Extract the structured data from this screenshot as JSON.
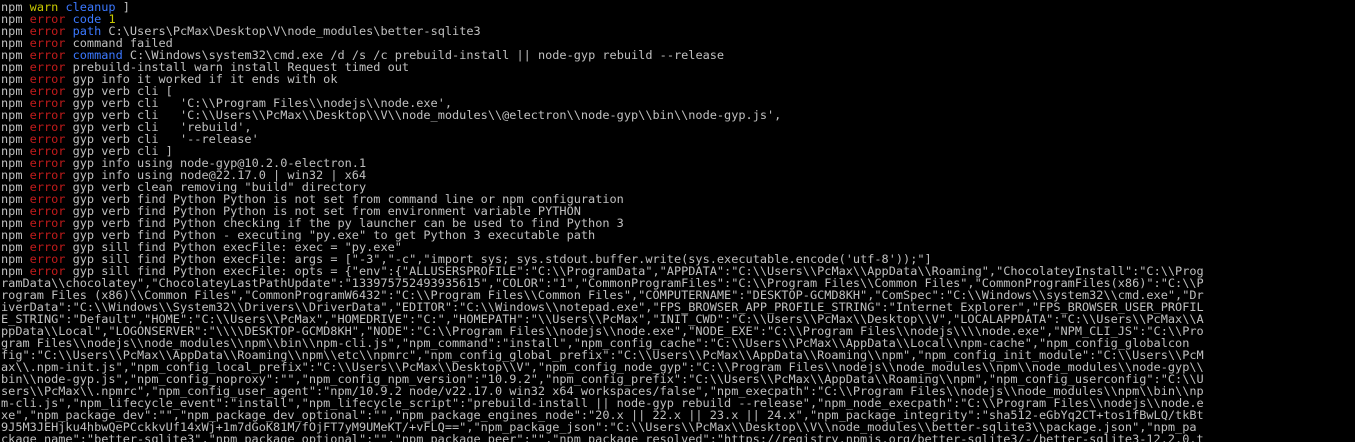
{
  "terminal": {
    "lines": [
      {
        "segments": [
          [
            "npm",
            "npm"
          ],
          [
            " ",
            "text"
          ],
          [
            "warn",
            "warn"
          ],
          [
            " ",
            "text"
          ],
          [
            "cleanup",
            "key"
          ],
          [
            " ]",
            "text"
          ]
        ]
      },
      {
        "segments": [
          [
            "npm",
            "npm"
          ],
          [
            " ",
            "text"
          ],
          [
            "error",
            "error"
          ],
          [
            " ",
            "text"
          ],
          [
            "code",
            "key"
          ],
          [
            " ",
            "text"
          ],
          [
            "1",
            "num"
          ]
        ]
      },
      {
        "segments": [
          [
            "npm",
            "npm"
          ],
          [
            " ",
            "text"
          ],
          [
            "error",
            "error"
          ],
          [
            " ",
            "text"
          ],
          [
            "path",
            "key"
          ],
          [
            " C:\\Users\\PcMax\\Desktop\\V\\node_modules\\better-sqlite3",
            "text"
          ]
        ]
      },
      {
        "segments": [
          [
            "npm",
            "npm"
          ],
          [
            " ",
            "text"
          ],
          [
            "error",
            "error"
          ],
          [
            " command failed",
            "text"
          ]
        ]
      },
      {
        "segments": [
          [
            "npm",
            "npm"
          ],
          [
            " ",
            "text"
          ],
          [
            "error",
            "error"
          ],
          [
            " ",
            "text"
          ],
          [
            "command",
            "key"
          ],
          [
            " C:\\Windows\\system32\\cmd.exe /d /s /c prebuild-install || node-gyp rebuild --release",
            "text"
          ]
        ]
      },
      {
        "segments": [
          [
            "npm",
            "npm"
          ],
          [
            " ",
            "text"
          ],
          [
            "error",
            "error"
          ],
          [
            " prebuild-install warn install Request timed out",
            "text"
          ]
        ]
      },
      {
        "segments": [
          [
            "npm",
            "npm"
          ],
          [
            " ",
            "text"
          ],
          [
            "error",
            "error"
          ],
          [
            " gyp info it worked if it ends with ok",
            "text"
          ]
        ]
      },
      {
        "segments": [
          [
            "npm",
            "npm"
          ],
          [
            " ",
            "text"
          ],
          [
            "error",
            "error"
          ],
          [
            " gyp verb cli [",
            "text"
          ]
        ]
      },
      {
        "segments": [
          [
            "npm",
            "npm"
          ],
          [
            " ",
            "text"
          ],
          [
            "error",
            "error"
          ],
          [
            " gyp verb cli   'C:\\\\Program Files\\\\nodejs\\\\node.exe',",
            "text"
          ]
        ]
      },
      {
        "segments": [
          [
            "npm",
            "npm"
          ],
          [
            " ",
            "text"
          ],
          [
            "error",
            "error"
          ],
          [
            " gyp verb cli   'C:\\\\Users\\\\PcMax\\\\Desktop\\\\V\\\\node_modules\\\\@electron\\\\node-gyp\\\\bin\\\\node-gyp.js',",
            "text"
          ]
        ]
      },
      {
        "segments": [
          [
            "npm",
            "npm"
          ],
          [
            " ",
            "text"
          ],
          [
            "error",
            "error"
          ],
          [
            " gyp verb cli   'rebuild',",
            "text"
          ]
        ]
      },
      {
        "segments": [
          [
            "npm",
            "npm"
          ],
          [
            " ",
            "text"
          ],
          [
            "error",
            "error"
          ],
          [
            " gyp verb cli   '--release'",
            "text"
          ]
        ]
      },
      {
        "segments": [
          [
            "npm",
            "npm"
          ],
          [
            " ",
            "text"
          ],
          [
            "error",
            "error"
          ],
          [
            " gyp verb cli ]",
            "text"
          ]
        ]
      },
      {
        "segments": [
          [
            "npm",
            "npm"
          ],
          [
            " ",
            "text"
          ],
          [
            "error",
            "error"
          ],
          [
            " gyp info using node-gyp@10.2.0-electron.1",
            "text"
          ]
        ]
      },
      {
        "segments": [
          [
            "npm",
            "npm"
          ],
          [
            " ",
            "text"
          ],
          [
            "error",
            "error"
          ],
          [
            " gyp info using node@22.17.0 | win32 | x64",
            "text"
          ]
        ]
      },
      {
        "segments": [
          [
            "npm",
            "npm"
          ],
          [
            " ",
            "text"
          ],
          [
            "error",
            "error"
          ],
          [
            " gyp verb clean removing \"build\" directory",
            "text"
          ]
        ]
      },
      {
        "segments": [
          [
            "npm",
            "npm"
          ],
          [
            " ",
            "text"
          ],
          [
            "error",
            "error"
          ],
          [
            " gyp verb find Python Python is not set from command line or npm configuration",
            "text"
          ]
        ]
      },
      {
        "segments": [
          [
            "npm",
            "npm"
          ],
          [
            " ",
            "text"
          ],
          [
            "error",
            "error"
          ],
          [
            " gyp verb find Python Python is not set from environment variable PYTHON",
            "text"
          ]
        ]
      },
      {
        "segments": [
          [
            "npm",
            "npm"
          ],
          [
            " ",
            "text"
          ],
          [
            "error",
            "error"
          ],
          [
            " gyp verb find Python checking if the py launcher can be used to find Python 3",
            "text"
          ]
        ]
      },
      {
        "segments": [
          [
            "npm",
            "npm"
          ],
          [
            " ",
            "text"
          ],
          [
            "error",
            "error"
          ],
          [
            " gyp verb find Python - executing \"py.exe\" to get Python 3 executable path",
            "text"
          ]
        ]
      },
      {
        "segments": [
          [
            "npm",
            "npm"
          ],
          [
            " ",
            "text"
          ],
          [
            "error",
            "error"
          ],
          [
            " gyp sill find Python execFile: exec = \"py.exe\"",
            "text"
          ]
        ]
      },
      {
        "segments": [
          [
            "npm",
            "npm"
          ],
          [
            " ",
            "text"
          ],
          [
            "error",
            "error"
          ],
          [
            " gyp sill find Python execFile: args = [\"-3\",\"-c\",\"import sys; sys.stdout.buffer.write(sys.executable.encode('utf-8'));\"]",
            "text"
          ]
        ]
      },
      {
        "segments": [
          [
            "npm",
            "npm"
          ],
          [
            " ",
            "text"
          ],
          [
            "error",
            "error"
          ],
          [
            " gyp sill find Python execFile: opts = {\"env\":{\"ALLUSERSPROFILE\":\"C:\\\\ProgramData\",\"APPDATA\":\"C:\\\\Users\\\\PcMax\\\\AppData\\\\Roaming\",\"ChocolateyInstall\":\"C:\\\\Prog",
            "text"
          ]
        ]
      },
      {
        "segments": [
          [
            "ramData\\\\chocolatey\",\"ChocolateyLastPathUpdate\":\"133975752493935615\",\"COLOR\":\"1\",\"CommonProgramFiles\":\"C:\\\\Program Files\\\\Common Files\",\"CommonProgramFiles(x86)\":\"C:\\\\P",
            "text"
          ]
        ]
      },
      {
        "segments": [
          [
            "rogram Files (x86)\\\\Common Files\",\"CommonProgramW6432\":\"C:\\\\Program Files\\\\Common Files\",\"COMPUTERNAME\":\"DESKTOP-GCMD8KH\",\"ComSpec\":\"C:\\\\Windows\\\\system32\\\\cmd.exe\",\"Dr",
            "text"
          ]
        ]
      },
      {
        "segments": [
          [
            "iverData\":\"C:\\\\Windows\\\\System32\\\\Drivers\\\\DriverData\",\"EDITOR\":\"C:\\\\Windows\\\\notepad.exe\",\"FPS_BROWSER_APP_PROFILE_STRING\":\"Internet Explorer\",\"FPS_BROWSER_USER_PROFIL",
            "text"
          ]
        ]
      },
      {
        "segments": [
          [
            "E_STRING\":\"Default\",\"HOME\":\"C:\\\\Users\\\\PcMax\",\"HOMEDRIVE\":\"C:\",\"HOMEPATH\":\"\\\\Users\\\\PcMax\",\"INIT_CWD\":\"C:\\\\Users\\\\PcMax\\\\Desktop\\\\V\",\"LOCALAPPDATA\":\"C:\\\\Users\\\\PcMax\\\\A",
            "text"
          ]
        ]
      },
      {
        "segments": [
          [
            "ppData\\\\Local\",\"LOGONSERVER\":\"\\\\\\\\DESKTOP-GCMD8KH\",\"NODE\":\"C:\\\\Program Files\\\\nodejs\\\\node.exe\",\"NODE_EXE\":\"C:\\\\Program Files\\\\nodejs\\\\\\\\node.exe\",\"NPM_CLI_JS\":\"C:\\\\Pro",
            "text"
          ]
        ]
      },
      {
        "segments": [
          [
            "gram Files\\\\nodejs\\\\node_modules\\\\npm\\\\bin\\\\npm-cli.js\",\"npm_command\":\"install\",\"npm_config_cache\":\"C:\\\\Users\\\\PcMax\\\\AppData\\\\Local\\\\npm-cache\",\"npm_config_globalcon",
            "text"
          ]
        ]
      },
      {
        "segments": [
          [
            "fig\":\"C:\\\\Users\\\\PcMax\\\\AppData\\\\Roaming\\\\npm\\\\etc\\\\npmrc\",\"npm_config_global_prefix\":\"C:\\\\Users\\\\PcMax\\\\AppData\\\\Roaming\\\\npm\",\"npm_config_init_module\":\"C:\\\\Users\\\\PcM",
            "text"
          ]
        ]
      },
      {
        "segments": [
          [
            "ax\\\\.npm-init.js\",\"npm_config_local_prefix\":\"C:\\\\Users\\\\PcMax\\\\Desktop\\\\V\",\"npm_config_node_gyp\":\"C:\\\\Program Files\\\\nodejs\\\\node_modules\\\\npm\\\\node_modules\\\\node-gyp\\\\",
            "text"
          ]
        ]
      },
      {
        "segments": [
          [
            "bin\\\\node-gyp.js\",\"npm_config_noproxy\":\"\",\"npm_config_npm_version\":\"10.9.2\",\"npm_config_prefix\":\"C:\\\\Users\\\\PcMax\\\\AppData\\\\Roaming\\\\npm\",\"npm_config_userconfig\":\"C:\\\\U",
            "text"
          ]
        ]
      },
      {
        "segments": [
          [
            "sers\\\\PcMax\\\\.npmrc\",\"npm_config_user_agent\":\"npm/10.9.2 node/v22.17.0 win32 x64 workspaces/false\",\"npm_execpath\":\"C:\\\\Program Files\\\\nodejs\\\\node_modules\\\\npm\\\\bin\\\\np",
            "text"
          ]
        ]
      },
      {
        "segments": [
          [
            "m-cli.js\",\"npm_lifecycle_event\":\"install\",\"npm_lifecycle_script\":\"prebuild-install || node-gyp rebuild --release\",\"npm_node_execpath\":\"C:\\\\Program Files\\\\nodejs\\\\node.e",
            "text"
          ]
        ]
      },
      {
        "segments": [
          [
            "xe\",\"npm_package_dev\":\"\",\"npm_package_dev_optional\":\"\",\"npm_package_engines_node\":\"20.x || 22.x || 23.x || 24.x\",\"npm_package_integrity\":\"sha512-eGbYq2CT+tos1fBwLQ/tkBt",
            "text"
          ]
        ]
      },
      {
        "segments": [
          [
            "9J5M3JEHjku4hbwQePCckkvUf14xWj+1m7dGoK81M/fOjFT7yM9UMeKT/+vFLQ==\",\"npm_package_json\":\"C:\\\\Users\\\\PcMax\\\\Desktop\\\\V\\\\node_modules\\\\better-sqlite3\\\\package.json\",\"npm_pa",
            "text"
          ]
        ]
      },
      {
        "segments": [
          [
            "ckage_name\":\"better-sqlite3\",\"npm_package_optional\":\"\",\"npm_package_peer\":\"\",\"npm_package_resolved\":\"https://registry.npmjs.org/better-sqlite3/-/better-sqlite3-12.2.0.t",
            "text"
          ]
        ]
      }
    ]
  },
  "colors": {
    "background": "#000000",
    "text": "#c0c0c0",
    "warn": "#c8c800",
    "error": "#c11b1b",
    "key": "#3b78ff"
  }
}
